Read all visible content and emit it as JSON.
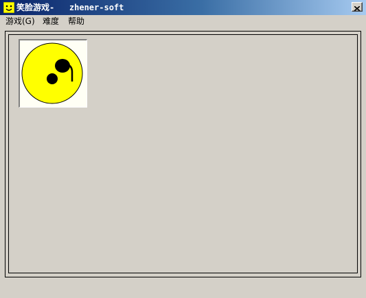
{
  "window": {
    "title": "笑脸游戏-   zhener-soft",
    "close_symbol": "×"
  },
  "menu": {
    "items": [
      {
        "label": "游戏(G)"
      },
      {
        "label": "难度"
      },
      {
        "label": "帮助"
      }
    ]
  },
  "game": {
    "faces": [
      {
        "icon": "sad-face-icon",
        "fill": "#ffff00"
      }
    ]
  },
  "colors": {
    "face_fill": "#ffff00",
    "face_features": "#000000",
    "window_background": "#d4d0c8",
    "titlebar_start": "#0a246a",
    "titlebar_end": "#a6caf0"
  }
}
